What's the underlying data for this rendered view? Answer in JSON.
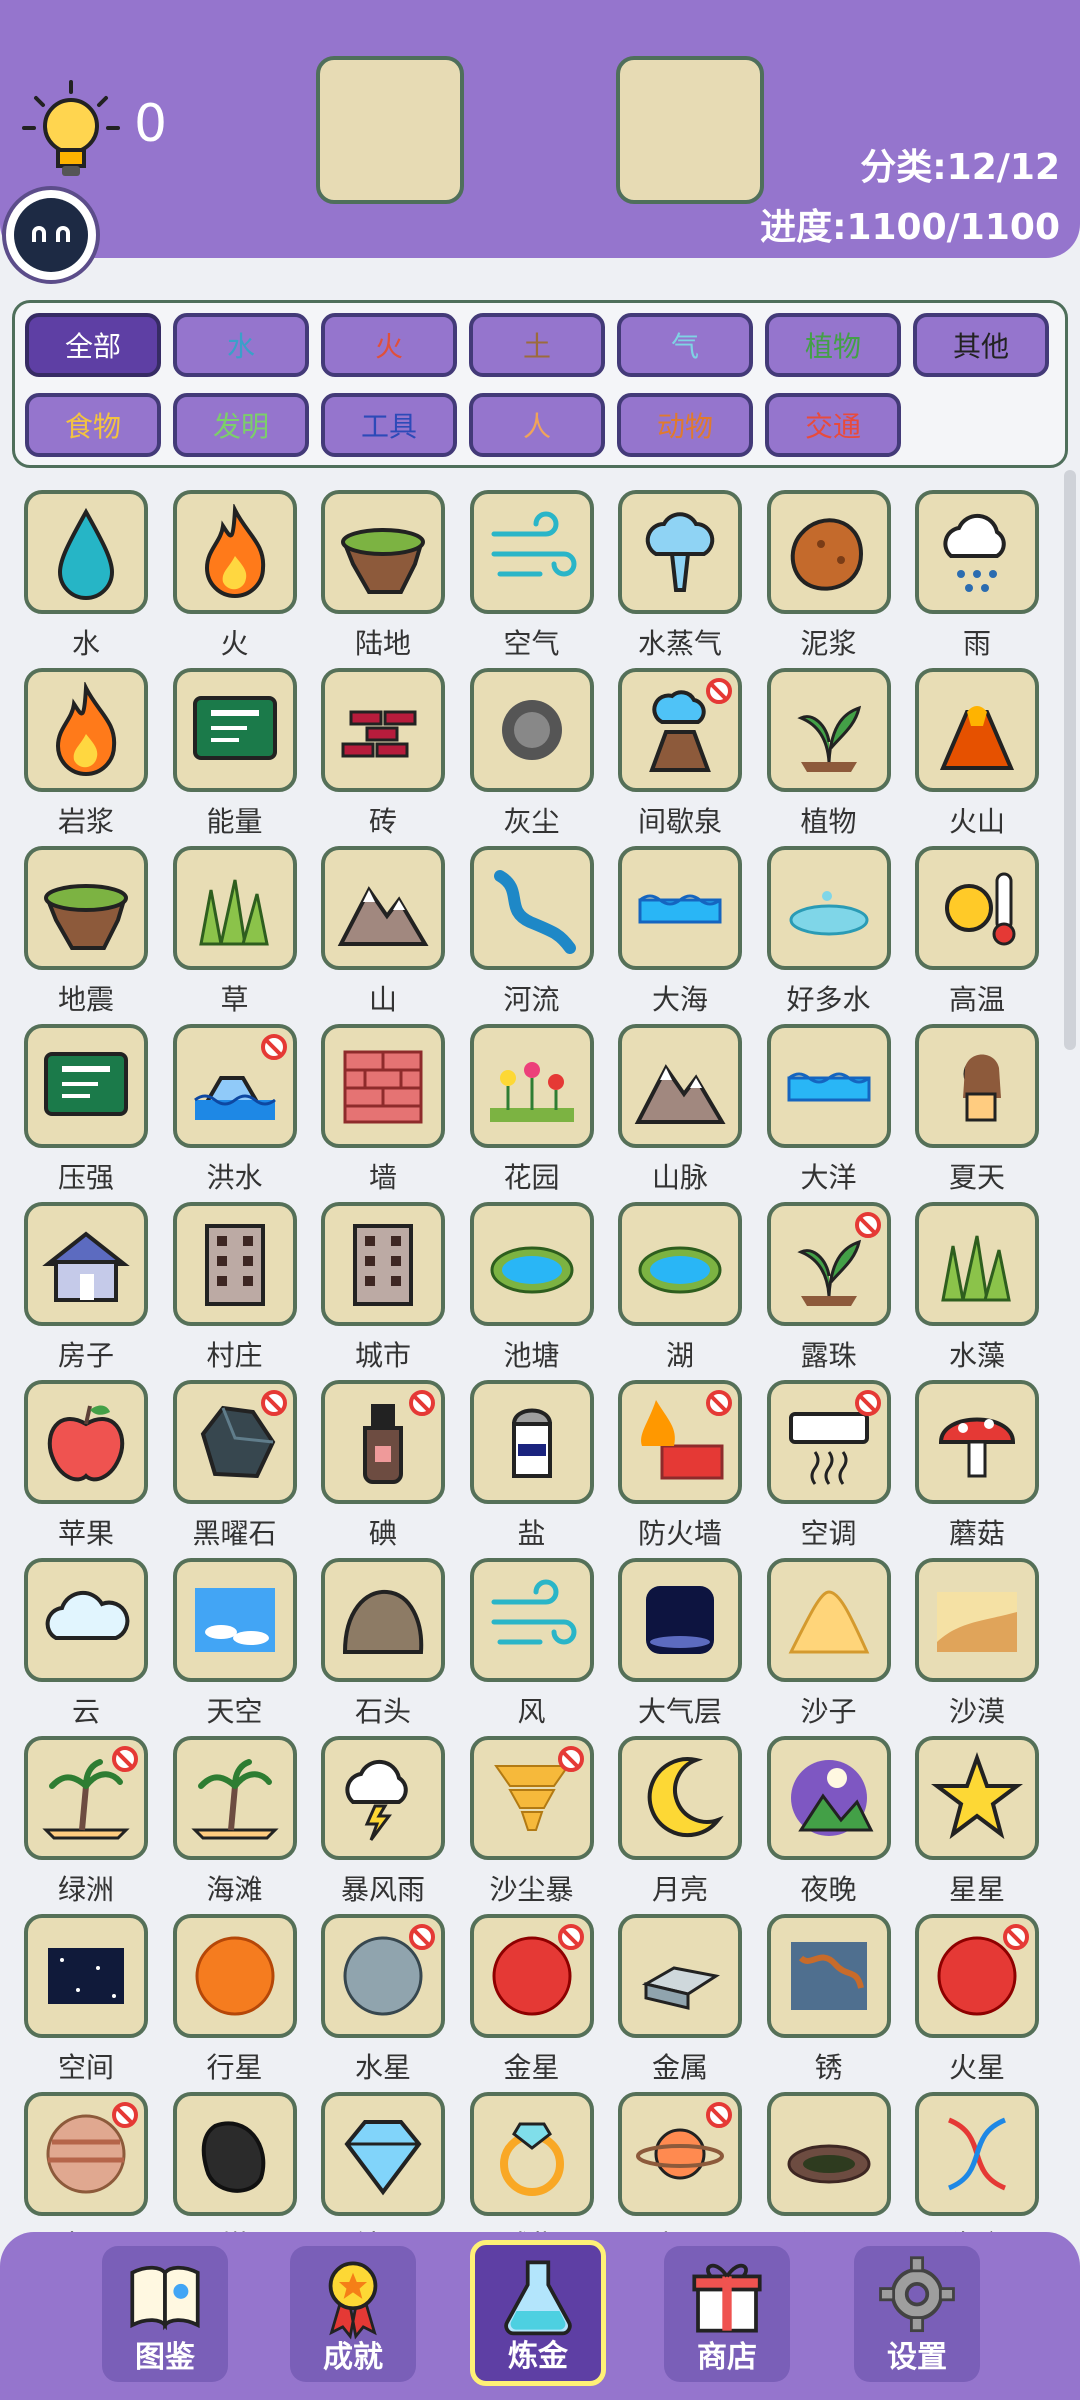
{
  "header": {
    "hint_count": "0",
    "category_stat": "分类:12/12",
    "progress_stat": "进度:1100/1100"
  },
  "categories": [
    {
      "label": "全部",
      "color": "#ffffff",
      "active": true
    },
    {
      "label": "水",
      "color": "#3aa0c9"
    },
    {
      "label": "火",
      "color": "#e0503a"
    },
    {
      "label": "土",
      "color": "#9c6b3c"
    },
    {
      "label": "气",
      "color": "#7fd3e4"
    },
    {
      "label": "植物",
      "color": "#43a047"
    },
    {
      "label": "其他",
      "color": "#222222"
    },
    {
      "label": "食物",
      "color": "#f3c340"
    },
    {
      "label": "发明",
      "color": "#7ccf6a"
    },
    {
      "label": "工具",
      "color": "#2d4ab8"
    },
    {
      "label": "人",
      "color": "#f0a45a"
    },
    {
      "label": "动物",
      "color": "#e07a2e"
    },
    {
      "label": "交通",
      "color": "#e84b3c"
    }
  ],
  "items": [
    {
      "name": "水",
      "icon": "drop",
      "locked": false
    },
    {
      "name": "火",
      "icon": "fire",
      "locked": false
    },
    {
      "name": "陆地",
      "icon": "land",
      "locked": false
    },
    {
      "name": "空气",
      "icon": "wind",
      "locked": false
    },
    {
      "name": "水蒸气",
      "icon": "steam",
      "locked": false
    },
    {
      "name": "泥浆",
      "icon": "mud",
      "locked": false
    },
    {
      "name": "雨",
      "icon": "rain",
      "locked": false
    },
    {
      "name": "岩浆",
      "icon": "fire",
      "locked": false
    },
    {
      "name": "能量",
      "icon": "board",
      "locked": false
    },
    {
      "name": "砖",
      "icon": "bricks",
      "locked": false
    },
    {
      "name": "灰尘",
      "icon": "dust",
      "locked": false
    },
    {
      "name": "间歇泉",
      "icon": "geyser",
      "locked": true
    },
    {
      "name": "植物",
      "icon": "plant",
      "locked": false
    },
    {
      "name": "火山",
      "icon": "volcano",
      "locked": false
    },
    {
      "name": "地震",
      "icon": "land",
      "locked": false
    },
    {
      "name": "草",
      "icon": "grass",
      "locked": false
    },
    {
      "name": "山",
      "icon": "mountain",
      "locked": false
    },
    {
      "name": "河流",
      "icon": "river",
      "locked": false
    },
    {
      "name": "大海",
      "icon": "waves",
      "locked": false
    },
    {
      "name": "好多水",
      "icon": "puddle",
      "locked": false
    },
    {
      "name": "高温",
      "icon": "sun",
      "locked": false
    },
    {
      "name": "压强",
      "icon": "board",
      "locked": false
    },
    {
      "name": "洪水",
      "icon": "flood",
      "locked": true
    },
    {
      "name": "墙",
      "icon": "wall",
      "locked": false
    },
    {
      "name": "花园",
      "icon": "garden",
      "locked": false
    },
    {
      "name": "山脉",
      "icon": "mountain",
      "locked": false
    },
    {
      "name": "大洋",
      "icon": "waves",
      "locked": false
    },
    {
      "name": "夏天",
      "icon": "summer",
      "locked": false
    },
    {
      "name": "房子",
      "icon": "house",
      "locked": false
    },
    {
      "name": "村庄",
      "icon": "building",
      "locked": false
    },
    {
      "name": "城市",
      "icon": "building",
      "locked": false
    },
    {
      "name": "池塘",
      "icon": "pond",
      "locked": false
    },
    {
      "name": "湖",
      "icon": "pond",
      "locked": false
    },
    {
      "name": "露珠",
      "icon": "plant",
      "locked": true
    },
    {
      "name": "水藻",
      "icon": "grass",
      "locked": false
    },
    {
      "name": "苹果",
      "icon": "apple",
      "locked": false
    },
    {
      "name": "黑曜石",
      "icon": "rock",
      "locked": true
    },
    {
      "name": "碘",
      "icon": "bottle",
      "locked": true
    },
    {
      "name": "盐",
      "icon": "salt",
      "locked": false
    },
    {
      "name": "防火墙",
      "icon": "firewall",
      "locked": true
    },
    {
      "name": "空调",
      "icon": "ac",
      "locked": true
    },
    {
      "name": "蘑菇",
      "icon": "mushroom",
      "locked": false
    },
    {
      "name": "云",
      "icon": "cloud",
      "locked": false
    },
    {
      "name": "天空",
      "icon": "sky",
      "locked": false
    },
    {
      "name": "石头",
      "icon": "stone",
      "locked": false
    },
    {
      "name": "风",
      "icon": "wind",
      "locked": false
    },
    {
      "name": "大气层",
      "icon": "atmosphere",
      "locked": false
    },
    {
      "name": "沙子",
      "icon": "sand",
      "locked": false
    },
    {
      "name": "沙漠",
      "icon": "desert",
      "locked": false
    },
    {
      "name": "绿洲",
      "icon": "palm",
      "locked": true
    },
    {
      "name": "海滩",
      "icon": "palm",
      "locked": false
    },
    {
      "name": "暴风雨",
      "icon": "storm",
      "locked": false
    },
    {
      "name": "沙尘暴",
      "icon": "tornado",
      "locked": true
    },
    {
      "name": "月亮",
      "icon": "moon",
      "locked": false
    },
    {
      "name": "夜晚",
      "icon": "night",
      "locked": false
    },
    {
      "name": "星星",
      "icon": "star",
      "locked": false
    },
    {
      "name": "空间",
      "icon": "space",
      "locked": false
    },
    {
      "name": "行星",
      "icon": "planet-orange",
      "locked": false
    },
    {
      "name": "水星",
      "icon": "planet-gray",
      "locked": true
    },
    {
      "name": "金星",
      "icon": "planet-red",
      "locked": true
    },
    {
      "name": "金属",
      "icon": "metal",
      "locked": false
    },
    {
      "name": "锈",
      "icon": "rust",
      "locked": false
    },
    {
      "name": "火星",
      "icon": "planet-red",
      "locked": true
    },
    {
      "name": "木星",
      "icon": "planet-stripe",
      "locked": true
    },
    {
      "name": "煤",
      "icon": "coal",
      "locked": false
    },
    {
      "name": "钻石",
      "icon": "diamond",
      "locked": false
    },
    {
      "name": "戒指",
      "icon": "ring",
      "locked": false
    },
    {
      "name": "土星",
      "icon": "saturn",
      "locked": true
    },
    {
      "name": "沼泽",
      "icon": "swamp",
      "locked": false
    },
    {
      "name": "生命",
      "icon": "dna",
      "locked": false
    }
  ],
  "nav": [
    {
      "label": "图鉴",
      "icon": "book-icon"
    },
    {
      "label": "成就",
      "icon": "medal-icon"
    },
    {
      "label": "炼金",
      "icon": "flask-icon",
      "active": true
    },
    {
      "label": "商店",
      "icon": "gift-icon"
    },
    {
      "label": "设置",
      "icon": "gear-icon"
    }
  ]
}
